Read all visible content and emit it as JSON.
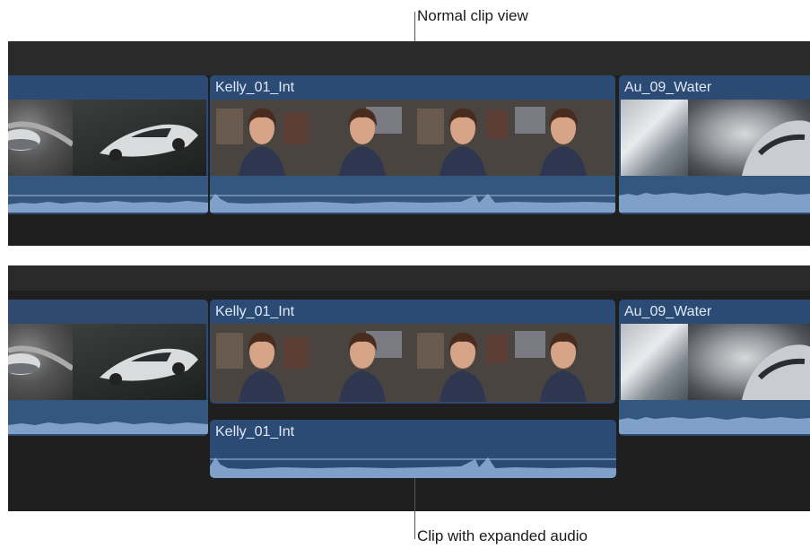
{
  "callouts": {
    "top": "Normal clip view",
    "bottom": "Clip with expanded audio"
  },
  "top_timeline": {
    "clips": [
      {
        "name": "",
        "frames": [
          "road-car-icon",
          "silver-car-icon"
        ]
      },
      {
        "name": "Kelly_01_Int",
        "frames": [
          "woman-icon",
          "woman-icon",
          "woman-icon",
          "woman-icon"
        ]
      },
      {
        "name": "Au_09_Water",
        "frames": [
          "silver-car-icon",
          "water-spray-icon"
        ]
      }
    ]
  },
  "bottom_timeline": {
    "clips": [
      {
        "name": "",
        "frames": [
          "road-car-icon",
          "silver-car-icon"
        ]
      },
      {
        "name": "Kelly_01_Int",
        "frames": [
          "woman-icon",
          "woman-icon",
          "woman-icon",
          "woman-icon"
        ]
      },
      {
        "name": "Au_09_Water",
        "frames": [
          "silver-car-icon",
          "water-spray-icon"
        ]
      }
    ],
    "expanded_audio": {
      "name": "Kelly_01_Int"
    }
  },
  "colors": {
    "timeline_bg": "#1f1f1f",
    "clip_blue": "#2f4a6e",
    "waveform": "#7fa0c8"
  }
}
